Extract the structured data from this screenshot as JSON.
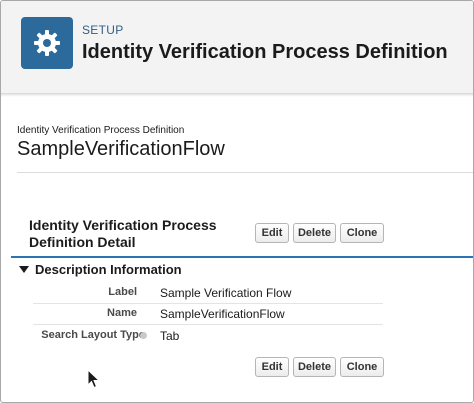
{
  "header": {
    "section": "SETUP",
    "title": "Identity Verification Process Definition",
    "icon": "gear-icon",
    "icon_bg": "#2b6a9b"
  },
  "record": {
    "type_label": "Identity Verification Process Definition",
    "name": "SampleVerificationFlow"
  },
  "detail": {
    "title": "Identity Verification Process Definition Detail",
    "buttons": {
      "edit": "Edit",
      "delete": "Delete",
      "clone": "Clone"
    }
  },
  "section": {
    "title": "Description Information",
    "fields": [
      {
        "label": "Label",
        "value": "Sample Verification Flow"
      },
      {
        "label": "Name",
        "value": "SampleVerificationFlow"
      },
      {
        "label": "Search Layout Type",
        "value": "Tab"
      }
    ]
  },
  "colors": {
    "accent": "#2a73b5",
    "setup_text": "#2f5f8a"
  }
}
